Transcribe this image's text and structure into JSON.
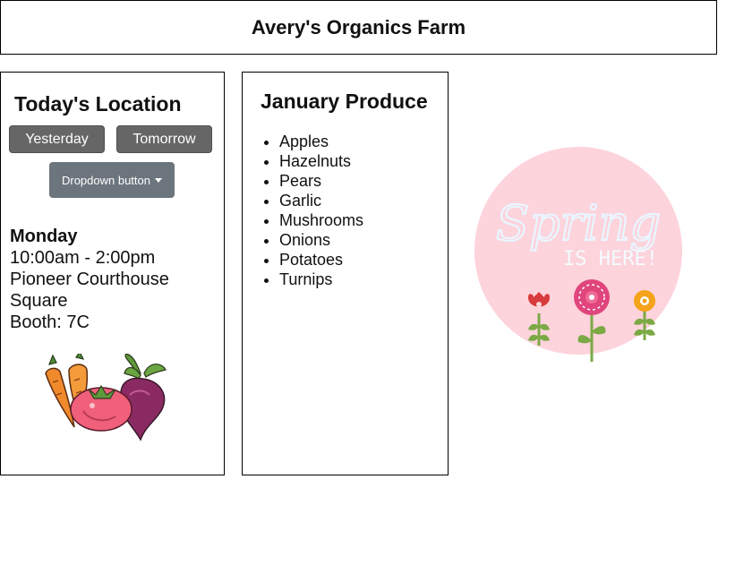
{
  "header": {
    "title": "Avery's Organics Farm"
  },
  "location": {
    "title": "Today's Location",
    "buttons": {
      "yesterday": "Yesterday",
      "tomorrow": "Tomorrow"
    },
    "dropdown_label": "Dropdown button",
    "day": "Monday",
    "hours": "10:00am - 2:00pm",
    "place_line1": "Pioneer Courthouse",
    "place_line2": "Square",
    "booth": "Booth: 7C",
    "image_icon": "vegetables-illustration"
  },
  "produce": {
    "title": "January Produce",
    "items": [
      "Apples",
      "Hazelnuts",
      "Pears",
      "Garlic",
      "Mushrooms",
      "Onions",
      "Potatoes",
      "Turnips"
    ]
  },
  "spring_graphic": {
    "text_main": "Spring",
    "text_sub": "IS HERE!",
    "colors": {
      "circle": "#fdd3dc",
      "text": "#e9f6ff",
      "leaf": "#7ba944",
      "flower_red": "#d83b3b",
      "flower_pink": "#e0457b",
      "flower_orange": "#f5a31a"
    }
  },
  "colors": {
    "button_dark": "#666666",
    "dropdown": "#6c757d"
  }
}
